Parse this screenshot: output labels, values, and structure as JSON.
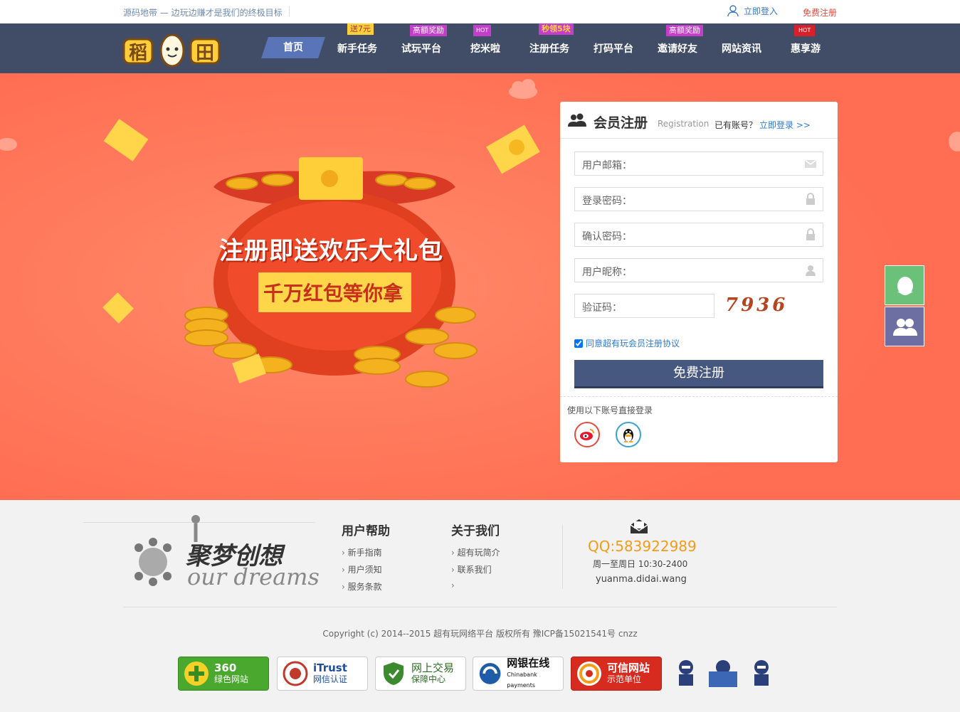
{
  "topbar": {
    "slogan": "源码地带 — 边玩边赚才是我们的终极目标",
    "login": "立即登入",
    "register": "免费注册"
  },
  "nav": {
    "logo_text": "稻 田",
    "items": [
      {
        "label": "首页"
      },
      {
        "label": "新手任务",
        "badge": "送7元"
      },
      {
        "label": "试玩平台",
        "badge": "高额奖励"
      },
      {
        "label": "挖米啦",
        "badge": "HOT"
      },
      {
        "label": "注册任务",
        "badge": "秒领5块"
      },
      {
        "label": "打码平台"
      },
      {
        "label": "邀请好友",
        "badge": "高额奖励"
      },
      {
        "label": "网站资讯"
      },
      {
        "label": "惠享游",
        "badge": "HOT"
      }
    ]
  },
  "hero": {
    "line1": "注册即送欢乐大礼包",
    "line2": "千万红包等你拿"
  },
  "register": {
    "title": "会员注册",
    "subtitle": "Registration",
    "have_account": "已有账号？",
    "login_now": "立即登录 >>",
    "fields": {
      "email": "用户邮箱：",
      "password": "登录密码：",
      "confirm": "确认密码：",
      "nickname": "用户昵称：",
      "captcha": "验证码："
    },
    "captcha_code": "7936",
    "agree_text": "同意超有玩会员注册协议",
    "submit": "免费注册",
    "oauth_text": "使用以下账号直接登录"
  },
  "footer": {
    "brand_cn": "聚梦创想",
    "brand_en": "our dreams",
    "help": {
      "title": "用户帮助",
      "links": [
        "新手指南",
        "用户须知",
        "服务条款"
      ]
    },
    "about": {
      "title": "关于我们",
      "links": [
        "超有玩简介",
        "联系我们",
        ""
      ]
    },
    "qq": "QQ:583922989",
    "hours": "周一至周日 10:30-2400",
    "site": "yuanma.didai.wang",
    "copyright": "Copyright (c) 2014--2015 超有玩网络平台 版权所有 豫ICP备15021541号   cnzz",
    "badges": [
      {
        "t1": "360",
        "t2": "绿色网站"
      },
      {
        "t1": "iTrust",
        "t2": "网信认证"
      },
      {
        "t1": "网上交易",
        "t2": "保障中心"
      },
      {
        "t1": "网银在线",
        "t2": "Chinabank payments"
      },
      {
        "t1": "可信网站",
        "t2": "示范单位"
      }
    ]
  }
}
